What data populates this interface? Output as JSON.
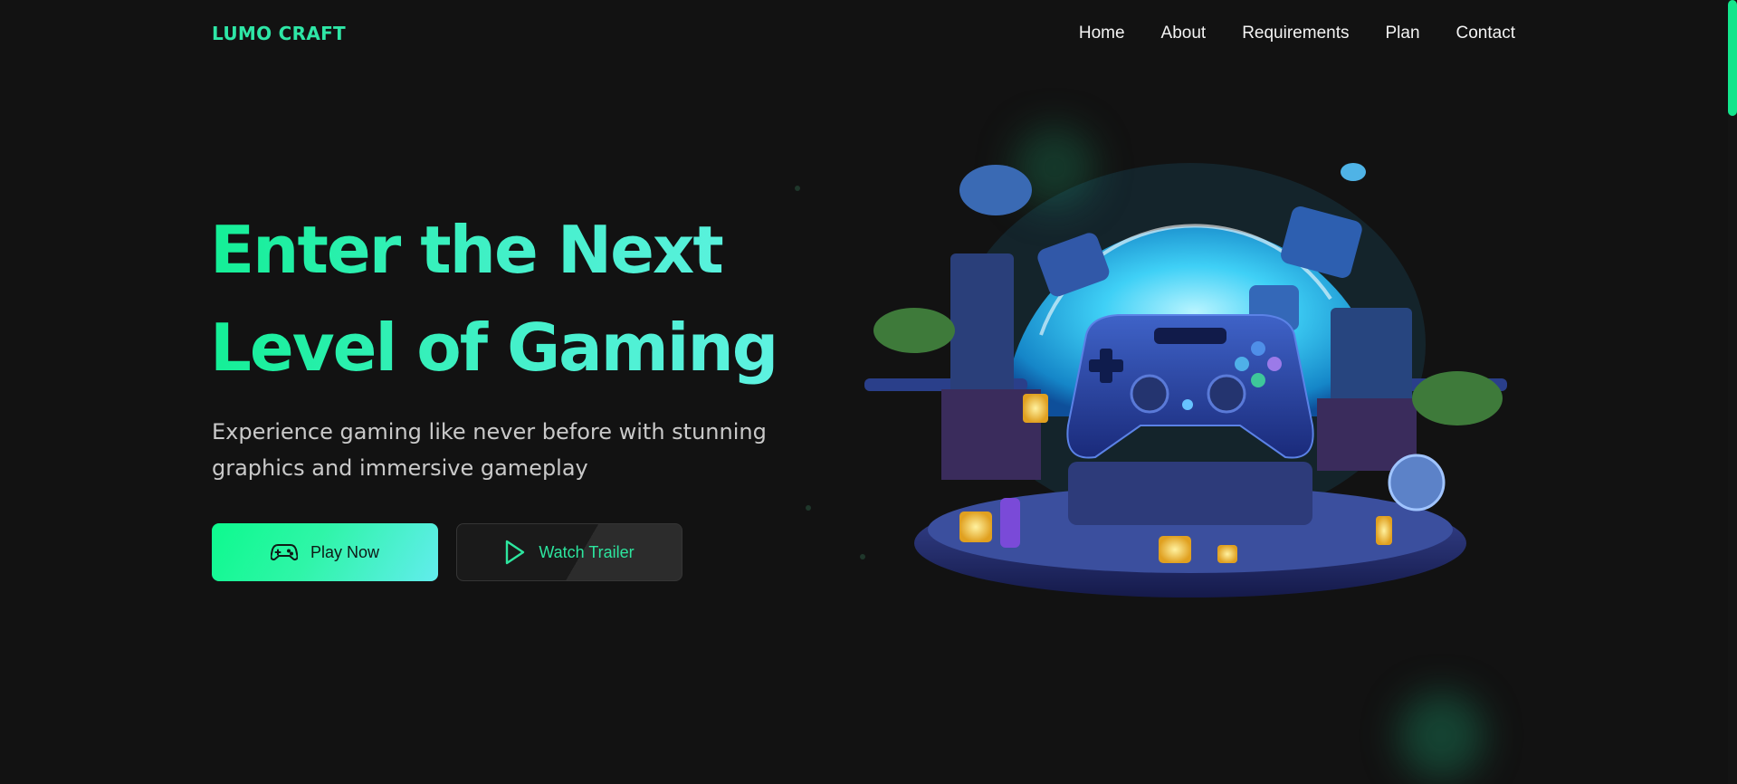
{
  "brand": {
    "logo_text": "LUMO CRAFT"
  },
  "nav": {
    "items": [
      {
        "label": "Home"
      },
      {
        "label": "About"
      },
      {
        "label": "Requirements"
      },
      {
        "label": "Plan"
      },
      {
        "label": "Contact"
      }
    ]
  },
  "hero": {
    "title_line1": "Enter the Next",
    "title_line2": "Level of Gaming",
    "subtitle": "Experience gaming like never before with stunning graphics and immersive gameplay",
    "buttons": {
      "play_label": "Play Now",
      "play_icon": "gamepad-icon",
      "trailer_label": "Watch Trailer",
      "trailer_icon": "play-triangle-icon"
    }
  },
  "colors": {
    "background": "#121212",
    "accent": "#14ef96",
    "accent_cyan": "#5ff2e2",
    "nav_text": "#f3f3f3"
  },
  "illustration": {
    "subject": "controller-dome-illustration"
  }
}
